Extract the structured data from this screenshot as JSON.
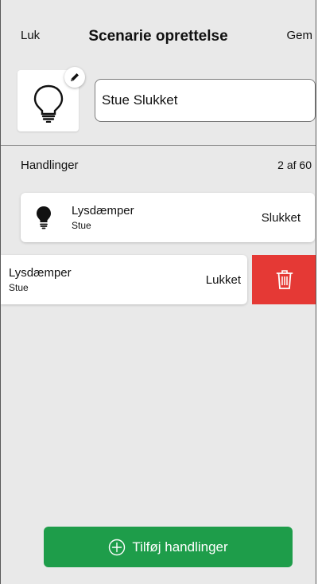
{
  "header": {
    "close_label": "Luk",
    "title": "Scenarie oprettelse",
    "save_label": "Gem"
  },
  "scene": {
    "name": "Stue Slukket",
    "icon": "lightbulb-icon",
    "edit_icon": "pencil-icon"
  },
  "actions": {
    "title": "Handlinger",
    "count": "2 af 60",
    "items": [
      {
        "title": "Lysdæmper",
        "subtitle": "Stue",
        "state": "Slukket",
        "icon": "lightbulb-filled-icon"
      },
      {
        "title": "Lysdæmper",
        "subtitle": "Stue",
        "state": "Lukket",
        "icon": "none"
      }
    ],
    "delete_icon": "trash-icon"
  },
  "footer": {
    "add_label": "Tilføj handlinger",
    "add_icon": "plus-circle-icon"
  },
  "colors": {
    "background": "#e9e9e9",
    "delete": "#e53935",
    "primary_green": "#1e9d4a"
  }
}
